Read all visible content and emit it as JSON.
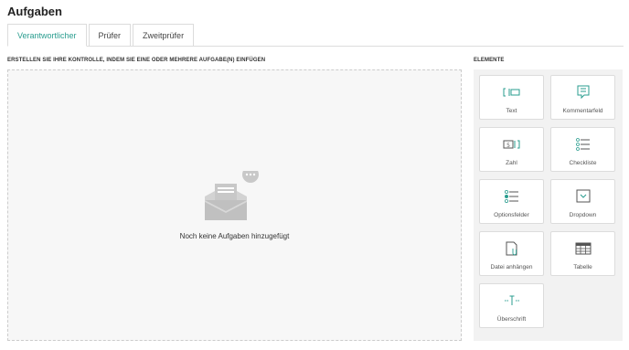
{
  "header": {
    "title": "Aufgaben"
  },
  "tabs": [
    {
      "label": "Verantwortlicher",
      "active": true
    },
    {
      "label": "Prüfer",
      "active": false
    },
    {
      "label": "Zweitprüfer",
      "active": false
    }
  ],
  "builder": {
    "instruction": "ERSTELLEN SIE IHRE KONTROLLE, INDEM SIE EINE ODER MEHRERE AUFGABE(N) EINFÜGEN",
    "empty_message": "Noch keine Aufgaben hinzugefügt"
  },
  "elements": {
    "heading": "ELEMENTE",
    "items": [
      {
        "label": "Text",
        "icon": "text-field-icon"
      },
      {
        "label": "Kommentarfeld",
        "icon": "comment-icon"
      },
      {
        "label": "Zahl",
        "icon": "number-field-icon"
      },
      {
        "label": "Checkliste",
        "icon": "checklist-icon"
      },
      {
        "label": "Optionsfelder",
        "icon": "radio-options-icon"
      },
      {
        "label": "Dropdown",
        "icon": "dropdown-icon"
      },
      {
        "label": "Datei anhängen",
        "icon": "attach-file-icon"
      },
      {
        "label": "Tabelle",
        "icon": "table-icon"
      },
      {
        "label": "Überschrift",
        "icon": "heading-icon"
      }
    ]
  },
  "colors": {
    "accent": "#2a9d8f",
    "panel_bg": "#f2f2f2",
    "dropzone_bg": "#f7f7f7"
  }
}
